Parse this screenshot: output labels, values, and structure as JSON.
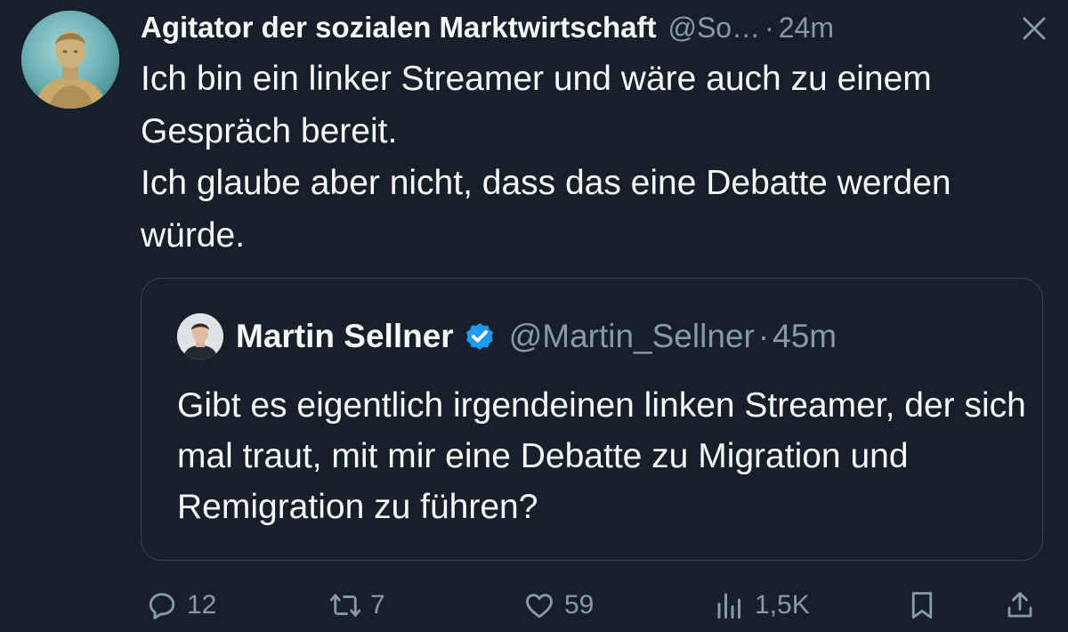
{
  "tweet": {
    "author": {
      "display_name": "Agitator der sozialen Marktwirtschaft",
      "handle": "@So…",
      "separator": "·",
      "time": "24m",
      "avatar_icon": "roman-bust-avatar"
    },
    "text": "Ich bin ein linker Streamer und wäre auch zu einem Gespräch bereit.\nIch glaube aber nicht, dass das eine Debatte werden würde.",
    "close_icon": "close-icon"
  },
  "quote": {
    "author": {
      "display_name": "Martin Sellner",
      "verified": true,
      "handle": "@Martin_Sellner",
      "separator": "·",
      "time": "45m"
    },
    "text": "Gibt es eigentlich irgendeinen linken Streamer, der sich mal traut, mit mir eine Debatte zu Migration und Remigration zu führen?"
  },
  "actions": {
    "replies": "12",
    "retweets": "7",
    "likes": "59",
    "views": "1,5K"
  },
  "colors": {
    "background": "#15202b",
    "text_primary": "#f7f9f9",
    "text_secondary": "#8b98a5",
    "border": "#38444d",
    "verified_blue": "#1d9bf0"
  }
}
